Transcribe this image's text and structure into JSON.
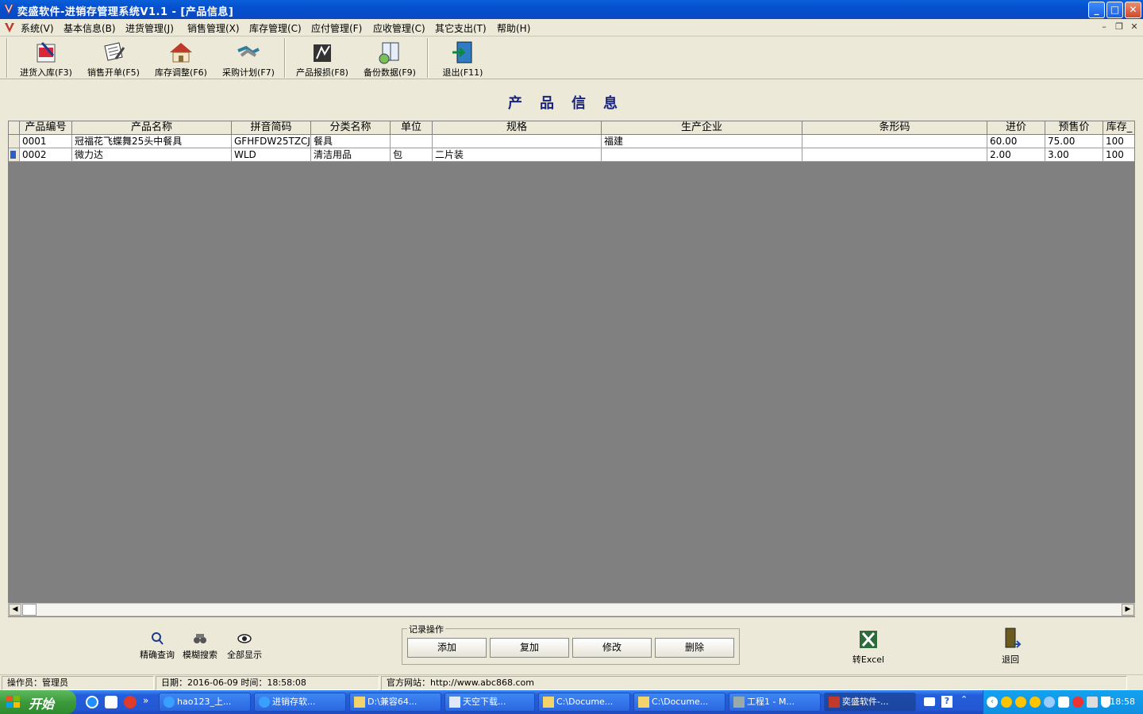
{
  "window": {
    "title": "奕盛软件-进销存管理系统V1.1 - [产品信息]",
    "min": "_",
    "max": "□",
    "close": "✕"
  },
  "menu": [
    "系统(V)",
    "基本信息(B)",
    "进货管理(J)",
    "销售管理(X)",
    "库存管理(C)",
    "应付管理(F)",
    "应收管理(C)",
    "其它支出(T)",
    "帮助(H)"
  ],
  "mdi": {
    "min": "–",
    "restore": "❐",
    "close": "✕"
  },
  "toolbar": [
    "进货入库(F3)",
    "销售开单(F5)",
    "库存调整(F6)",
    "采购计划(F7)",
    "产品报损(F8)",
    "备份数据(F9)",
    "退出(F11)"
  ],
  "heading": "产品信息",
  "table": {
    "columns": [
      "产品编号",
      "产品名称",
      "拼音简码",
      "分类名称",
      "单位",
      "规格",
      "生产企业",
      "条形码",
      "进价",
      "预售价",
      "库存_"
    ],
    "rows": [
      [
        "0001",
        "冠福花飞蝶舞25头中餐具",
        "GFHFDW25TZCJ",
        "餐具",
        "",
        "",
        "福建",
        "",
        "60.00",
        "75.00",
        "100"
      ],
      [
        "0002",
        "微力达",
        "WLD",
        "清洁用品",
        "包",
        "二片装",
        "",
        "",
        "2.00",
        "3.00",
        "100"
      ]
    ],
    "selected_row": 1
  },
  "search": {
    "exact": "精确查询",
    "fuzzy": "模糊搜索",
    "all": "全部显示"
  },
  "record_ops": {
    "legend": "记录操作",
    "add": "添加",
    "copy": "复加",
    "edit": "修改",
    "delete": "删除"
  },
  "export": "转Excel",
  "back": "退回",
  "status": {
    "operator": "操作员：管理员",
    "datetime": "日期：2016-06-09  时间：18:58:08",
    "website": "官方网站：http://www.abc868.com"
  },
  "taskbar": {
    "start": "开始",
    "tasks": [
      "hao123_上...",
      "进销存软...",
      "D:\\兼容64...",
      "天空下载...",
      "C:\\Docume...",
      "C:\\Docume...",
      "工程1 - M...",
      "奕盛软件-..."
    ],
    "clock": "18:58"
  },
  "colors": {
    "titlebar": "#0a5fd8",
    "heading": "#1a237e",
    "grid_bg": "#808080",
    "taskbar": "#245edb",
    "start": "#3c9a3c"
  }
}
